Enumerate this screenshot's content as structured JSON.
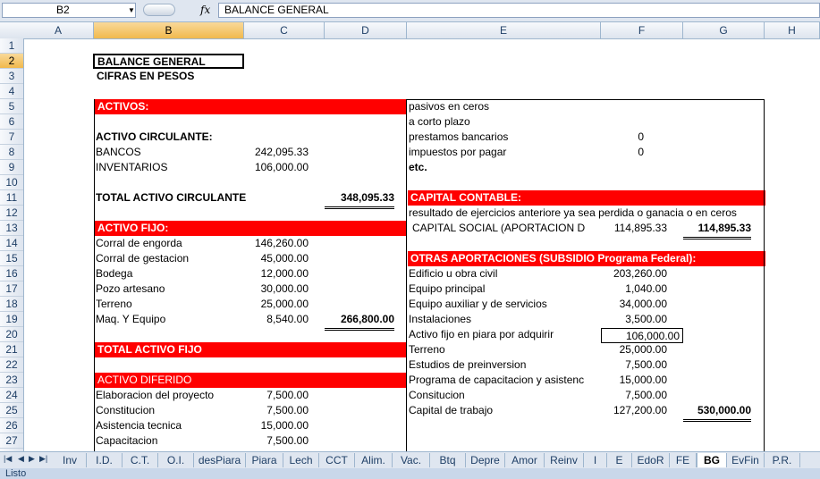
{
  "formula_bar": {
    "name_box": "B2",
    "fx": "fx",
    "formula": "BALANCE GENERAL"
  },
  "columns": [
    "A",
    "B",
    "C",
    "D",
    "E",
    "F",
    "G",
    "H"
  ],
  "rows": [
    "1",
    "2",
    "3",
    "4",
    "5",
    "6",
    "7",
    "8",
    "9",
    "10",
    "11",
    "12",
    "13",
    "14",
    "15",
    "16",
    "17",
    "18",
    "19",
    "20",
    "21",
    "22",
    "23",
    "24",
    "25",
    "26",
    "27"
  ],
  "title": "BALANCE GENERAL",
  "subtitle": "CIFRAS EN PESOS",
  "left": {
    "activos": "ACTIVOS:",
    "activo_circulante": "ACTIVO CIRCULANTE:",
    "bancos": {
      "label": "BANCOS",
      "value": "242,095.33"
    },
    "inventarios": {
      "label": "INVENTARIOS",
      "value": "106,000.00"
    },
    "total_circulante": {
      "label": "TOTAL ACTIVO CIRCULANTE",
      "value": "348,095.33"
    },
    "activo_fijo": "ACTIVO FIJO:",
    "fijo_items": [
      {
        "label": "Corral de engorda",
        "value": "146,260.00"
      },
      {
        "label": "Corral de gestacion",
        "value": "45,000.00"
      },
      {
        "label": "Bodega",
        "value": "12,000.00"
      },
      {
        "label": "Pozo artesano",
        "value": "30,000.00"
      },
      {
        "label": "Terreno",
        "value": "25,000.00"
      },
      {
        "label": "Maq. Y Equipo",
        "value": "8,540.00"
      }
    ],
    "fijo_subtotal": "266,800.00",
    "total_fijo": "TOTAL ACTIVO FIJO",
    "activo_diferido": "ACTIVO DIFERIDO",
    "diferido_items": [
      {
        "label": "Elaboracion del proyecto",
        "value": "7,500.00"
      },
      {
        "label": "Constitucion",
        "value": "7,500.00"
      },
      {
        "label": "Asistencia tecnica",
        "value": "15,000.00"
      },
      {
        "label": "Capacitacion",
        "value": "7,500.00"
      }
    ]
  },
  "right": {
    "pasivos_ceros": "pasivos en ceros",
    "corto_plazo": "a corto plazo",
    "prestamos": {
      "label": "prestamos bancarios",
      "value": "0"
    },
    "impuestos": {
      "label": "impuestos por pagar",
      "value": "0"
    },
    "etc": "etc.",
    "capital_contable": "CAPITAL CONTABLE:",
    "resultado": "resultado de ejercicios anteriore ya sea perdida o ganacia o en ceros",
    "capital_social": {
      "label": "CAPITAL SOCIAL (APORTACION D",
      "value": "114,895.33",
      "total": "114,895.33"
    },
    "otras_aportaciones": "OTRAS APORTACIONES (SUBSIDIO Programa Federal):",
    "items": [
      {
        "label": "Edificio u obra civil",
        "value": "203,260.00"
      },
      {
        "label": "Equipo principal",
        "value": "1,040.00"
      },
      {
        "label": "Equipo auxiliar y de servicios",
        "value": "34,000.00"
      },
      {
        "label": "Instalaciones",
        "value": "3,500.00"
      },
      {
        "label": "Activo fijo en piara por adquirir",
        "value": "106,000.00"
      },
      {
        "label": "Terreno",
        "value": "25,000.00"
      },
      {
        "label": "Estudios de preinversion",
        "value": "7,500.00"
      },
      {
        "label": "Programa de capacitacion y asistenc",
        "value": "15,000.00"
      },
      {
        "label": "Consitucion",
        "value": "7,500.00"
      },
      {
        "label": "Capital de trabajo",
        "value": "127,200.00"
      }
    ],
    "aportaciones_total": "530,000.00"
  },
  "sheet_tabs": [
    "Inv",
    "I.D.",
    "C.T.",
    "O.I.",
    "desPiara",
    "Piara",
    "Lech",
    "CCT",
    "Alim.",
    "Vac.",
    "Btq",
    "Depre",
    "Amor",
    "Reinv",
    "I",
    "E",
    "EdoR",
    "FE",
    "BG",
    "EvFin",
    "P.R."
  ],
  "active_tab": "BG",
  "status": "Listo"
}
